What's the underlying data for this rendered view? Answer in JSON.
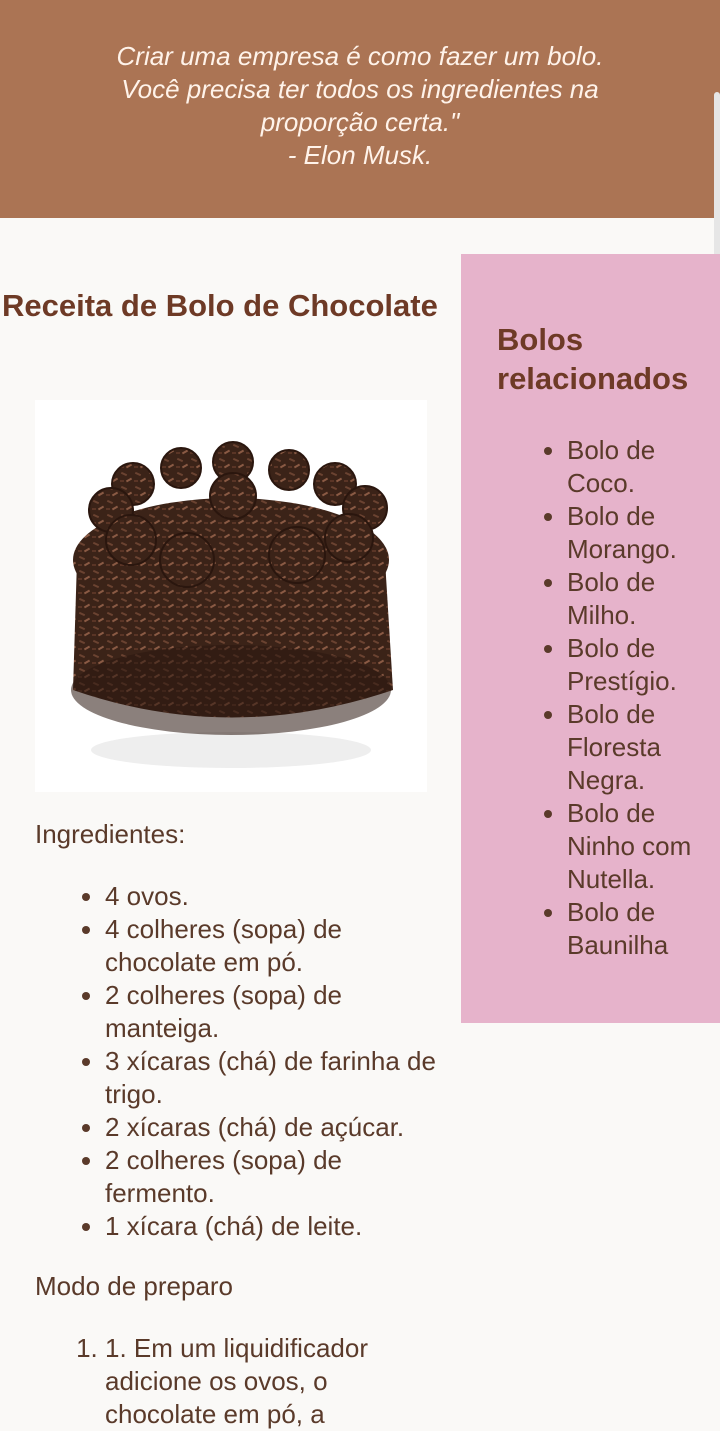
{
  "quote": {
    "line1": "Criar uma empresa é como fazer um bolo.",
    "line2": "Você precisa ter todos os ingredientes na",
    "line3": "proporção certa.\"",
    "author": "- Elon Musk."
  },
  "recipe": {
    "title": "Receita de Bolo de Chocolate",
    "ingredients_label": "Ingredientes:",
    "ingredients": [
      "4 ovos.",
      "4 colheres (sopa) de chocolate em pó.",
      "2 colheres (sopa) de manteiga.",
      "3 xícaras (chá) de farinha de trigo.",
      "2 xícaras (chá) de açúcar.",
      "2 colheres (sopa) de fermento.",
      "1 xícara (chá) de leite."
    ],
    "prep_label": "Modo de preparo",
    "steps": [
      "1. Em um liquidificador adicione os ovos, o chocolate em pó, a"
    ]
  },
  "sidebar": {
    "title": "Bolos relacionados",
    "items": [
      "Bolo de Coco.",
      "Bolo de Morango.",
      "Bolo de Milho.",
      "Bolo de Prestígio.",
      "Bolo de Floresta Negra.",
      "Bolo de Ninho com Nutella.",
      "Bolo de Baunilha"
    ]
  }
}
